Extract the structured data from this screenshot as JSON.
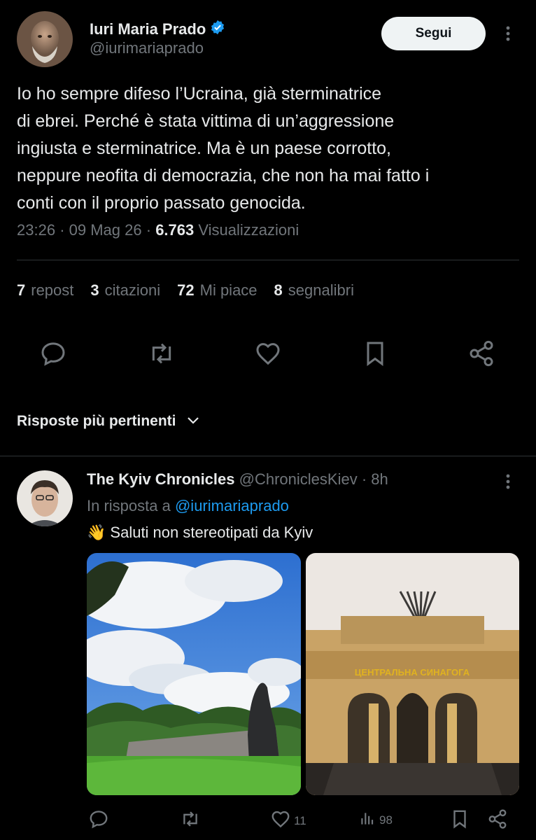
{
  "colors": {
    "background": "#000000",
    "text": "#e7e9ea",
    "muted": "#71767b",
    "link": "#1d9bf0",
    "divider": "#2f3336",
    "verified": "#1d9bf0"
  },
  "tweet": {
    "author_name": "Iuri Maria Prado",
    "author_handle": "@iurimariaprado",
    "follow_label": "Segui",
    "text": "Io ho sempre difeso l’Ucraina, già sterminatrice\ndi ebrei. Perché è stata vittima di un’aggressione\ningiusta e sterminatrice. Ma è un paese corrotto,\nneppure neofita di democrazia, che non ha mai fatto i\nconti con il proprio passato genocida.",
    "time": "23:26",
    "date": "09 Mag 26",
    "views_count": "6.763",
    "views_label": "Visualizzazioni",
    "stats": [
      {
        "count": "7",
        "label": "repost"
      },
      {
        "count": "3",
        "label": "citazioni"
      },
      {
        "count": "72",
        "label": "Mi piace"
      },
      {
        "count": "8",
        "label": "segnalibri"
      }
    ],
    "actions": [
      "reply-icon",
      "repost-icon",
      "like-icon",
      "bookmark-icon",
      "share-icon"
    ]
  },
  "replies_sort": {
    "label": "Risposte più pertinenti"
  },
  "reply": {
    "author_name": "The Kyiv Chronicles",
    "author_handle": "@ChroniclesKiev",
    "separator": "·",
    "age": "8h",
    "reply_prefix": "In risposta a",
    "reply_to": "@iurimariaprado",
    "emoji": "👋",
    "text": "Saluti non stereotipati da Kyiv",
    "images": [
      "park-monument-photo",
      "central-synagogue-photo"
    ],
    "synagogue_sign": "ЦЕНТРАЛЬНА СИНАГОГА",
    "actions": {
      "reply_count": "",
      "repost_count": "",
      "like_count": "11",
      "views_count": "98"
    }
  }
}
